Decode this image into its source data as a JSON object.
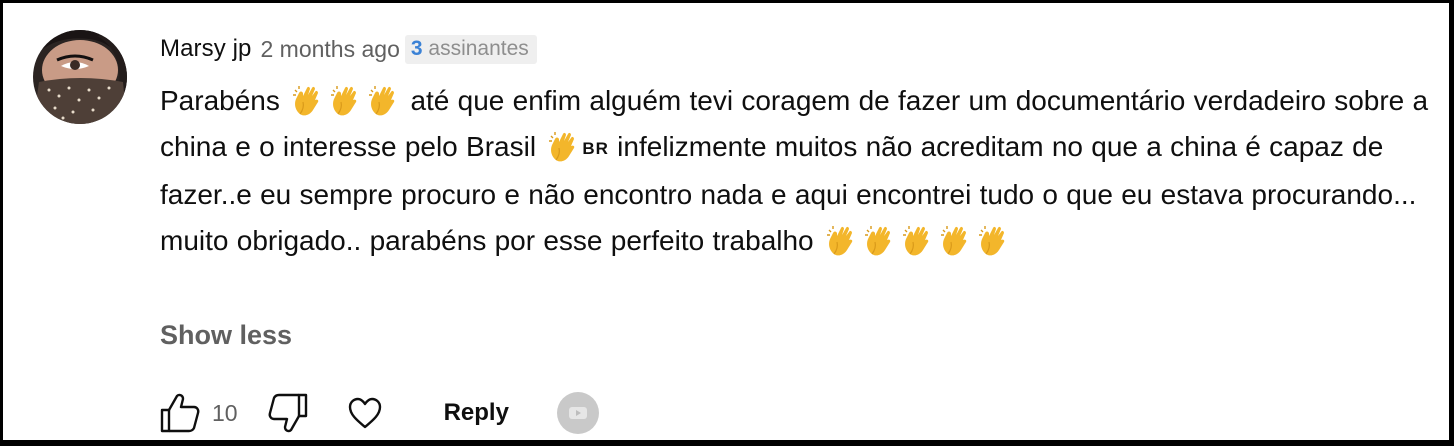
{
  "comment": {
    "author": "Marsy jp",
    "time": "2 months ago",
    "badge": {
      "count": "3",
      "label": "assinantes"
    },
    "text": {
      "part1": "Parabéns",
      "part2": "até que enfim alguém tevi coragem de fazer um documentário verdadeiro sobre a china e o interesse pelo Brasil",
      "flag": "BR",
      "part3": "infelizmente muitos não acreditam no que a china é capaz de fazer..e eu sempre procuro e não encontro nada e aqui encontrei tudo o que eu estava procurando... muito obrigado.. parabéns por esse perfeito trabalho"
    },
    "emoji": "clapping-hands",
    "show_less_label": "Show less",
    "likes": "10",
    "reply_label": "Reply"
  },
  "icons": {
    "like": "thumbs-up-icon",
    "dislike": "thumbs-down-icon",
    "heart": "heart-icon"
  },
  "colors": {
    "badge_count": "#3b82d6",
    "secondary_text": "#606060",
    "primary_text": "#0f0f0f",
    "emoji": "#f3b62b"
  }
}
